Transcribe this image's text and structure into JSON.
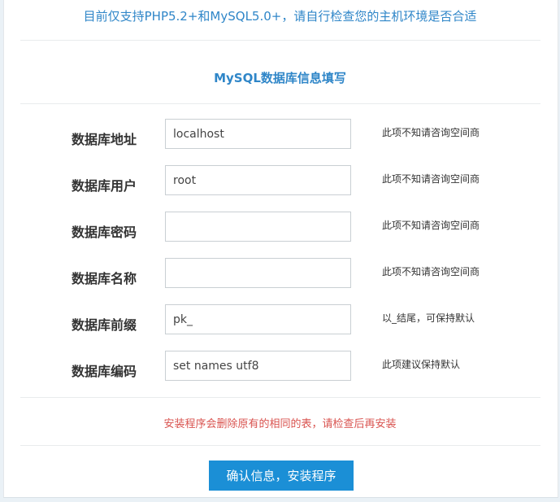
{
  "notice": "目前仅支持PHP5.2+和MySQL5.0+，请自行检查您的主机环境是否合适",
  "section_title": "MySQL数据库信息填写",
  "fields": [
    {
      "label": "数据库地址",
      "value": "localhost",
      "placeholder": "",
      "hint": "此项不知请咨询空间商"
    },
    {
      "label": "数据库用户",
      "value": "root",
      "placeholder": "",
      "hint": "此项不知请咨询空间商"
    },
    {
      "label": "数据库密码",
      "value": "",
      "placeholder": "",
      "hint": "此项不知请咨询空间商"
    },
    {
      "label": "数据库名称",
      "value": "",
      "placeholder": "",
      "hint": "此项不知请咨询空间商"
    },
    {
      "label": "数据库前缀",
      "value": "pk_",
      "placeholder": "",
      "hint": "以_结尾，可保持默认"
    },
    {
      "label": "数据库编码",
      "value": "set names utf8",
      "placeholder": "",
      "hint": "此项建议保持默认"
    }
  ],
  "warning": "安装程序会删除原有的相同的表，请检查后再安装",
  "submit_label": "确认信息，安装程序",
  "colors": {
    "accent": "#1b8fd6",
    "title_blue": "#2f86c8",
    "warning_red": "#d9534f"
  }
}
